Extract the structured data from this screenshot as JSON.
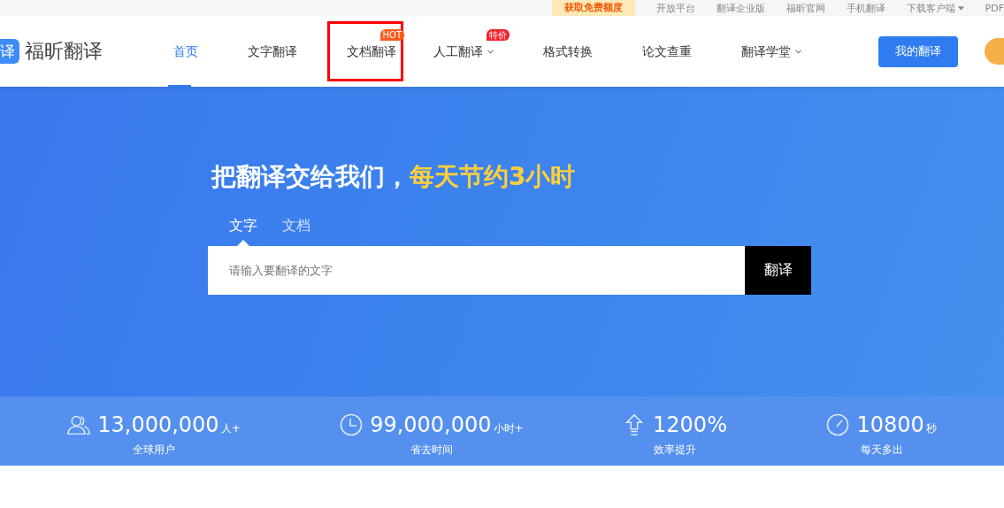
{
  "top_bar": {
    "promo": "获取免费额度",
    "links": [
      {
        "label": "开放平台",
        "dropdown": false
      },
      {
        "label": "翻译企业版",
        "dropdown": false
      },
      {
        "label": "福昕官网",
        "dropdown": false
      },
      {
        "label": "手机翻译",
        "dropdown": false
      },
      {
        "label": "下载客户端",
        "dropdown": true
      },
      {
        "label": "PDF",
        "dropdown": false
      }
    ]
  },
  "header": {
    "logo_mark": "译",
    "logo_text": "福昕翻译",
    "nav": [
      {
        "label": "首页",
        "selected": true,
        "dropdown": false,
        "highlighted": false
      },
      {
        "label": "文字翻译",
        "selected": false,
        "dropdown": false,
        "highlighted": false
      },
      {
        "label": "文档翻译",
        "selected": false,
        "dropdown": false,
        "highlighted": true,
        "badge": "HOT"
      },
      {
        "label": "人工翻译",
        "selected": false,
        "dropdown": true,
        "highlighted": false,
        "badge": "特价"
      },
      {
        "label": "格式转换",
        "selected": false,
        "dropdown": false,
        "highlighted": false
      },
      {
        "label": "论文查重",
        "selected": false,
        "dropdown": false,
        "highlighted": false
      },
      {
        "label": "翻译学堂",
        "selected": false,
        "dropdown": true,
        "highlighted": false
      }
    ],
    "my_button": "我的翻译"
  },
  "hero": {
    "title": "把翻译交给我们，",
    "title_highlight": "每天节约3小时",
    "tabs": [
      {
        "label": "文字",
        "selected": true
      },
      {
        "label": "文档",
        "selected": false
      }
    ],
    "input": {
      "placeholder": "请输入要翻译的文字"
    },
    "translate_button": "翻译"
  },
  "stats": [
    {
      "kind": "users",
      "value": "13,000,000",
      "unit": "人+",
      "label": "全球用户"
    },
    {
      "kind": "time",
      "value": "99,000,000",
      "unit": "小时+",
      "label": "省去时间"
    },
    {
      "kind": "efficiency",
      "value": "1200%",
      "label": "效率提升"
    },
    {
      "kind": "speed",
      "value": "10800",
      "unit": "秒",
      "label": "每天多出"
    }
  ]
}
